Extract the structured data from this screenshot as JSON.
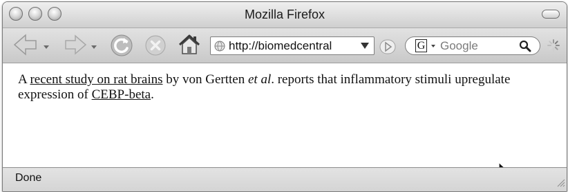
{
  "window": {
    "title": "Mozilla Firefox"
  },
  "toolbar": {
    "back_icon": "back-arrow-icon",
    "forward_icon": "forward-arrow-icon",
    "reload_icon": "reload-icon",
    "stop_icon": "stop-icon",
    "home_icon": "home-icon",
    "url": "http://biomedcentral",
    "go_icon": "go-arrow-icon",
    "search_engine_letter": "G",
    "search_placeholder": "Google",
    "throbber_icon": "loading-throbber-icon"
  },
  "content": {
    "t1": "A ",
    "link1": "recent study on rat brains",
    "t2": " by von Gertten ",
    "em": "et al",
    "t3": ". reports that inflammatory stimuli upregulate expression of ",
    "link2": "CEBP-beta",
    "t4": "."
  },
  "status": {
    "text": "Done"
  },
  "colors": {
    "chrome_top": "#efefef",
    "chrome_bottom": "#c9c9c9",
    "text": "#111111"
  }
}
